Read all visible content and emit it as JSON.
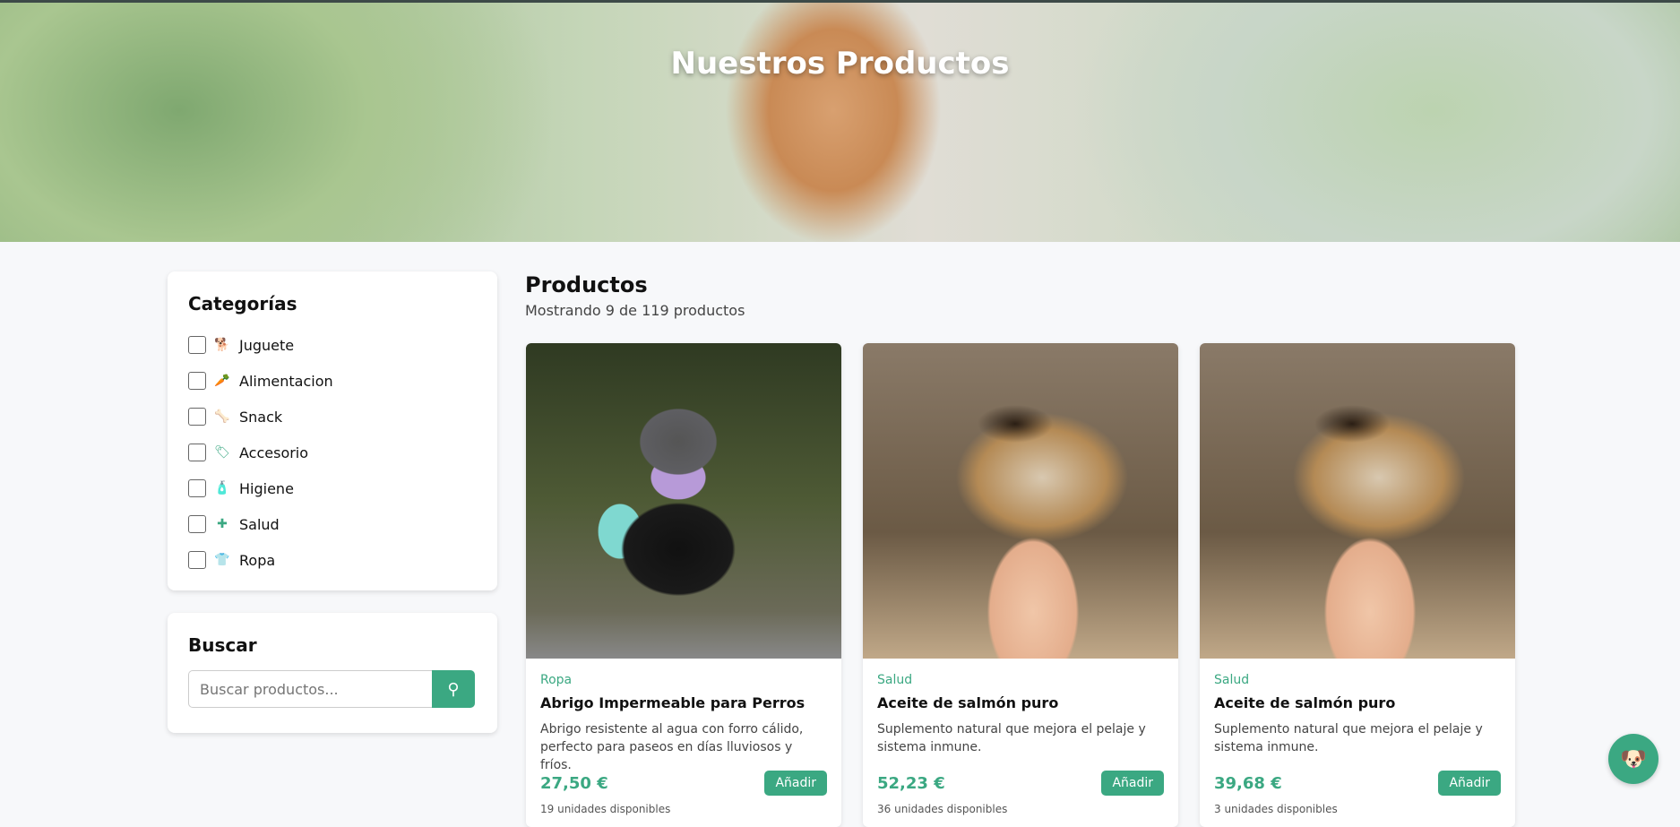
{
  "hero": {
    "title": "Nuestros Productos"
  },
  "sidebar": {
    "categories_title": "Categorías",
    "categories": [
      {
        "label": "Juguete",
        "icon": "dog-icon",
        "glyph": "🐕"
      },
      {
        "label": "Alimentacion",
        "icon": "carrot-icon",
        "glyph": "🥕"
      },
      {
        "label": "Snack",
        "icon": "bone-icon",
        "glyph": "🦴"
      },
      {
        "label": "Accesorio",
        "icon": "tag-icon",
        "glyph": "🏷"
      },
      {
        "label": "Higiene",
        "icon": "pump-soap-icon",
        "glyph": "🧴"
      },
      {
        "label": "Salud",
        "icon": "medkit-icon",
        "glyph": "✚"
      },
      {
        "label": "Ropa",
        "icon": "shirt-icon",
        "glyph": "👕"
      }
    ],
    "search_title": "Buscar",
    "search_placeholder": "Buscar productos...",
    "search_glyph": "⚲"
  },
  "main": {
    "title": "Productos",
    "subtitle": "Mostrando 9 de 119 productos",
    "products": [
      {
        "category": "Ropa",
        "name": "Abrigo Impermeable para Perros",
        "description": "Abrigo resistente al agua con forro cálido, perfecto para paseos en días lluviosos y fríos.",
        "price": "27,50 €",
        "button": "Añadir",
        "stock": "19 unidades disponibles"
      },
      {
        "category": "Salud",
        "name": "Aceite de salmón puro",
        "description": "Suplemento natural que mejora el pelaje y sistema inmune.",
        "price": "52,23 €",
        "button": "Añadir",
        "stock": "36 unidades disponibles"
      },
      {
        "category": "Salud",
        "name": "Aceite de salmón puro",
        "description": "Suplemento natural que mejora el pelaje y sistema inmune.",
        "price": "39,68 €",
        "button": "Añadir",
        "stock": "3 unidades disponibles"
      }
    ]
  },
  "chat": {
    "glyph": "🐶"
  },
  "colors": {
    "accent": "#3ba882"
  }
}
